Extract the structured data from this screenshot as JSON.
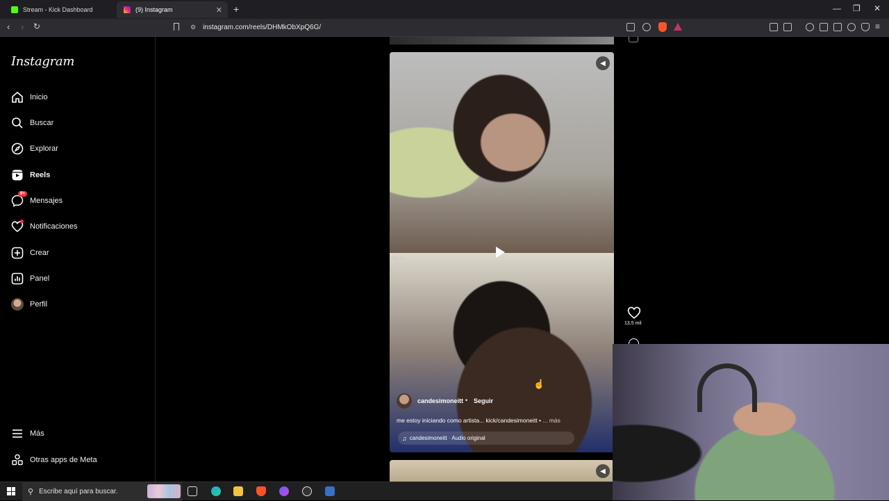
{
  "browser": {
    "tabs": [
      {
        "title": "Stream - Kick Dashboard",
        "favicon": "kick-logo-icon",
        "active": false
      },
      {
        "title": "(9) Instagram",
        "favicon": "instagram-logo-icon",
        "active": true
      }
    ],
    "new_tab_label": "+",
    "url": "instagram.com/reels/DHMkObXpQ6G/",
    "window_controls": {
      "minimize": "—",
      "restore": "❐",
      "close": "✕"
    }
  },
  "sidebar": {
    "logo": "Instagram",
    "items": [
      {
        "label": "Inicio",
        "icon": "home-icon"
      },
      {
        "label": "Buscar",
        "icon": "search-icon"
      },
      {
        "label": "Explorar",
        "icon": "compass-icon"
      },
      {
        "label": "Reels",
        "icon": "reels-icon",
        "active": true
      },
      {
        "label": "Mensajes",
        "icon": "messenger-icon",
        "badge": "9+"
      },
      {
        "label": "Notificaciones",
        "icon": "heart-icon"
      },
      {
        "label": "Crear",
        "icon": "plus-square-icon"
      },
      {
        "label": "Panel",
        "icon": "bar-chart-icon"
      },
      {
        "label": "Perfil",
        "icon": "avatar-icon"
      }
    ],
    "footer_items": [
      {
        "label": "Más",
        "icon": "menu-icon"
      },
      {
        "label": "Otras apps de Meta",
        "icon": "meta-apps-icon"
      }
    ]
  },
  "reel": {
    "watermark": "me.tv",
    "author": "candesimoneitt",
    "separator": "•",
    "follow_label": "Seguir",
    "caption": "me estoy iniciando como artista... kick/candesimoneitt •",
    "caption_more": " ... más",
    "audio": "candesimoneitt · Audio original",
    "likes": "13,5 mil"
  },
  "taskbar": {
    "search_placeholder": "Escribe aquí para buscar."
  },
  "colors": {
    "notification_red": "#ff3040",
    "instagram_bg": "#000000",
    "browser_chrome": "#2c2c31"
  }
}
